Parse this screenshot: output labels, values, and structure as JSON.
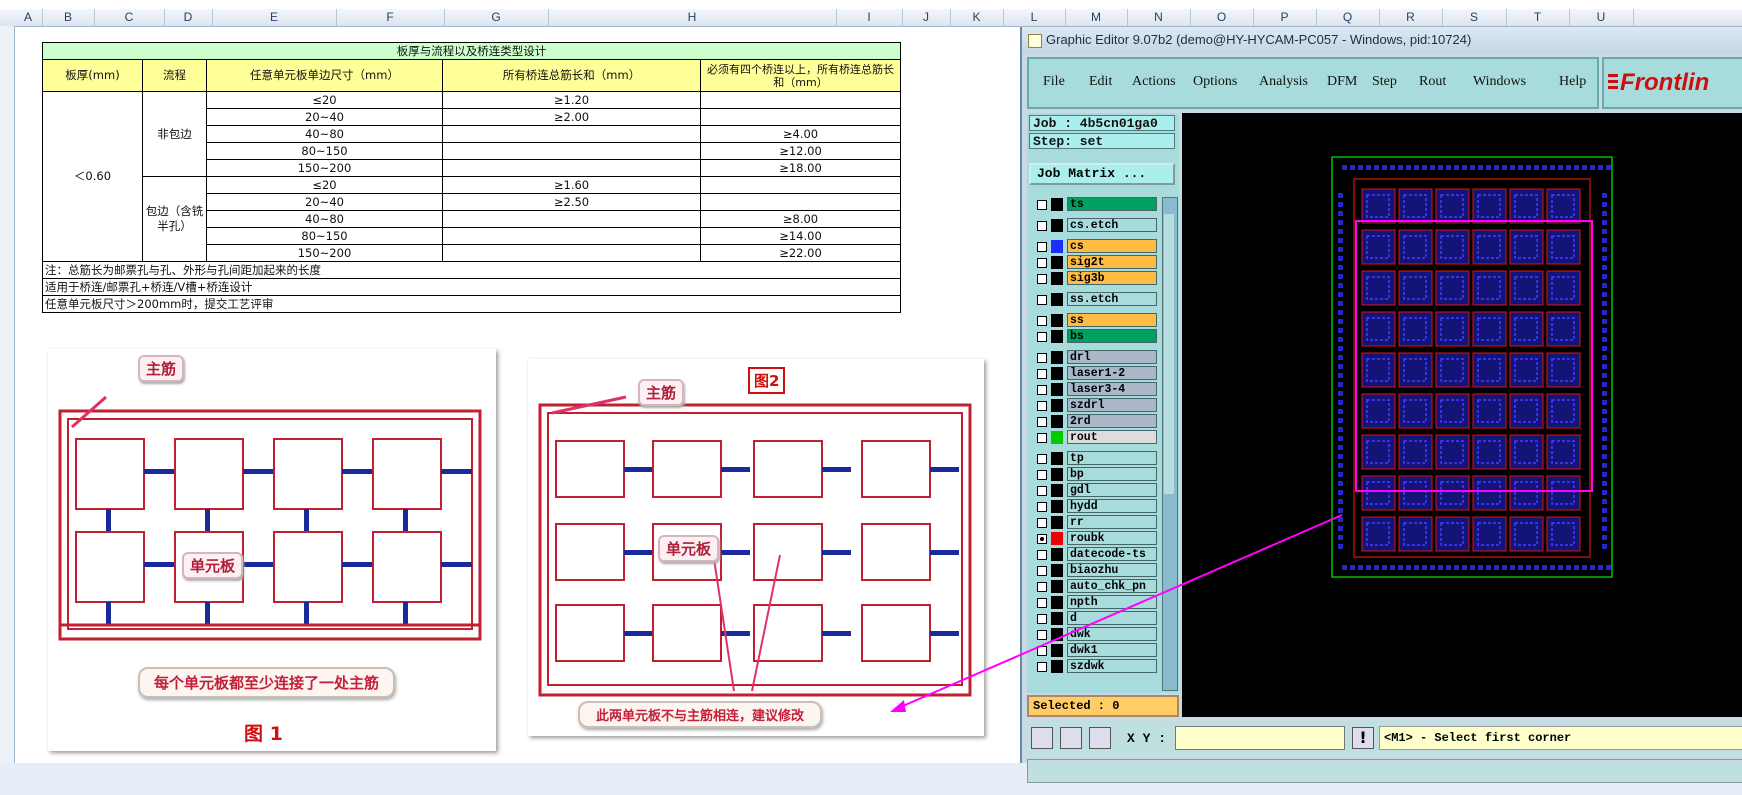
{
  "spreadsheet": {
    "columns": [
      "A",
      "B",
      "C",
      "D",
      "E",
      "F",
      "G",
      "H",
      "I",
      "J",
      "K",
      "L",
      "M",
      "N",
      "O",
      "P",
      "Q",
      "R",
      "S",
      "T",
      "U"
    ],
    "table": {
      "title": "板厚与流程以及桥连类型设计",
      "headers": [
        "板厚(mm)",
        "流程",
        "任意单元板单边尺寸（mm）",
        "所有桥连总筋长和（mm）",
        "必须有四个桥连以上，所有桥连总筋长和（mm）"
      ],
      "thickness": "＜0.60",
      "group1_label": "非包边",
      "group2_label": "包边（含铣半孔）",
      "rows": [
        {
          "size": "≤20",
          "total": "≥1.20",
          "four": ""
        },
        {
          "size": "20~40",
          "total": "≥2.00",
          "four": ""
        },
        {
          "size": "40~80",
          "total": "",
          "four": "≥4.00"
        },
        {
          "size": "80~150",
          "total": "",
          "four": "≥12.00"
        },
        {
          "size": "150~200",
          "total": "",
          "four": "≥18.00"
        },
        {
          "size": "≤20",
          "total": "≥1.60",
          "four": ""
        },
        {
          "size": "20~40",
          "total": "≥2.50",
          "four": ""
        },
        {
          "size": "40~80",
          "total": "",
          "four": "≥8.00"
        },
        {
          "size": "80~150",
          "total": "",
          "four": "≥14.00"
        },
        {
          "size": "150~200",
          "total": "",
          "four": "≥22.00"
        }
      ],
      "notes": [
        "注：总筋长为邮票孔与孔、外形与孔间距加起来的长度",
        "适用于桥连/邮票孔+桥连/V槽+桥连设计",
        "任意单元板尺寸＞200mm时，提交工艺评审"
      ]
    },
    "figure1": {
      "main_rib": "主筋",
      "unit": "单元板",
      "caption": "每个单元板都至少连接了一处主筋",
      "number": "图 1"
    },
    "figure2": {
      "main_rib": "主筋",
      "unit": "单元板",
      "caption": "此两单元板不与主筋相连，建议修改",
      "number": "图2"
    }
  },
  "graphic_editor": {
    "title": "Graphic Editor 9.07b2 (demo@HY-HYCAM-PC057 - Windows, pid:10724)",
    "menu": [
      "File",
      "Edit",
      "Actions",
      "Options",
      "Analysis",
      "DFM",
      "Step",
      "Rout",
      "Windows",
      "Help"
    ],
    "logo": "Frontlin",
    "job": "Job : 4b5cn01ga0",
    "step": "Step: set",
    "job_matrix_button": "Job Matrix ...",
    "layers": [
      {
        "name": "ts",
        "bg": "#00a060",
        "swatch": "#000",
        "checked": false
      },
      {
        "name": "cs.etch",
        "bg": "#a8dcdc",
        "swatch": "#000",
        "checked": false
      },
      {
        "name": "cs",
        "bg": "#ffbb44",
        "swatch": "#1a2fff",
        "checked": false
      },
      {
        "name": "sig2t",
        "bg": "#ffbb44",
        "swatch": "#000",
        "checked": false
      },
      {
        "name": "sig3b",
        "bg": "#ffbb44",
        "swatch": "#000",
        "checked": false
      },
      {
        "name": "ss.etch",
        "bg": "#a8dcdc",
        "swatch": "#000",
        "checked": false
      },
      {
        "name": "ss",
        "bg": "#ffbb44",
        "swatch": "#000",
        "checked": false
      },
      {
        "name": "bs",
        "bg": "#00a060",
        "swatch": "#000",
        "checked": false
      },
      {
        "name": "drl",
        "bg": "#a9b8c8",
        "swatch": "#000",
        "checked": false
      },
      {
        "name": "laser1-2",
        "bg": "#a9b8c8",
        "swatch": "#000",
        "checked": false
      },
      {
        "name": "laser3-4",
        "bg": "#a9b8c8",
        "swatch": "#000",
        "checked": false
      },
      {
        "name": "szdrl",
        "bg": "#a9b8c8",
        "swatch": "#000",
        "checked": false
      },
      {
        "name": "2rd",
        "bg": "#a9b8c8",
        "swatch": "#000",
        "checked": false
      },
      {
        "name": "rout",
        "bg": "#dddddd",
        "swatch": "#00cc00",
        "checked": false
      },
      {
        "name": "tp",
        "bg": "#a8dcdc",
        "swatch": "#000",
        "checked": false
      },
      {
        "name": "bp",
        "bg": "#a8dcdc",
        "swatch": "#000",
        "checked": false
      },
      {
        "name": "gdl",
        "bg": "#a8dcdc",
        "swatch": "#000",
        "checked": false
      },
      {
        "name": "hydd",
        "bg": "#a8dcdc",
        "swatch": "#000",
        "checked": false
      },
      {
        "name": "rr",
        "bg": "#a8dcdc",
        "swatch": "#000",
        "checked": false
      },
      {
        "name": "roubk",
        "bg": "#a8dcdc",
        "swatch": "#ee0000",
        "checked": true
      },
      {
        "name": "datecode-ts",
        "bg": "#a8dcdc",
        "swatch": "#000",
        "checked": false
      },
      {
        "name": "biaozhu",
        "bg": "#a8dcdc",
        "swatch": "#000",
        "checked": false
      },
      {
        "name": "auto_chk_pn",
        "bg": "#a8dcdc",
        "swatch": "#000",
        "checked": false
      },
      {
        "name": "npth",
        "bg": "#a8dcdc",
        "swatch": "#000",
        "checked": false
      },
      {
        "name": "d",
        "bg": "#a8dcdc",
        "swatch": "#000",
        "checked": false
      },
      {
        "name": "dwk",
        "bg": "#a8dcdc",
        "swatch": "#000",
        "checked": false
      },
      {
        "name": "dwk1",
        "bg": "#a8dcdc",
        "swatch": "#000",
        "checked": false
      },
      {
        "name": "szdwk",
        "bg": "#a8dcdc",
        "swatch": "#000",
        "checked": false
      }
    ],
    "selected": "Selected : 0",
    "xy_label": "X Y :",
    "xy_value": "",
    "message": "<M1> - Select first corner",
    "colors": {
      "accent": "#ff00ff",
      "board_outline": "#00c000",
      "rout": "#e01010",
      "copper": "#2020c0"
    }
  }
}
